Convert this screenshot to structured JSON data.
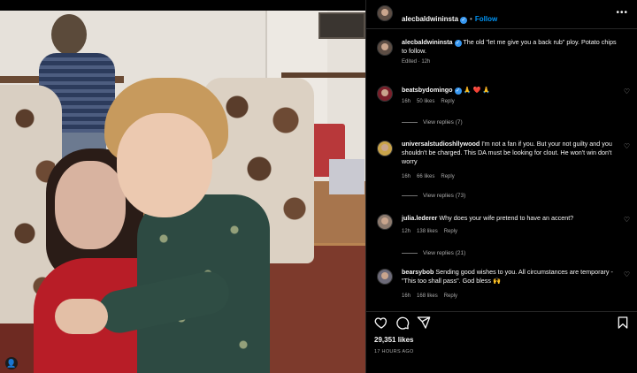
{
  "header": {
    "username": "alecbaldwininsta",
    "verified": true,
    "separator": "•",
    "follow_label": "Follow",
    "more_label": "•••"
  },
  "caption": {
    "username": "alecbaldwininsta",
    "text": "The old \"let me give you a back rub\" ploy. Potato chips to follow.",
    "meta": "Edited · 12h"
  },
  "comments": [
    {
      "username": "beatsbydomingo",
      "text": "🙏 ❤️ 🙏",
      "age": "16h",
      "likes": "50 likes",
      "reply": "Reply",
      "view_replies": "View replies (7)"
    },
    {
      "username": "universalstudioshllywood",
      "text": "I'm not a fan if you. But your not guilty and you shouldn't be charged. This DA must be looking for clout. He won't win don't worry",
      "age": "16h",
      "likes": "66 likes",
      "reply": "Reply",
      "view_replies": "View replies (73)"
    },
    {
      "username": "julia.lederer",
      "text": "Why does your wife pretend to have an accent?",
      "age": "12h",
      "likes": "138 likes",
      "reply": "Reply",
      "view_replies": "View replies (21)"
    },
    {
      "username": "bearsybob",
      "text": "Sending good wishes to you. All circumstances are temporary - \"This too shall pass\". God bless 🙌",
      "age": "16h",
      "likes": "168 likes",
      "reply": "Reply"
    }
  ],
  "actions": {
    "likes_count": "29,351 likes",
    "posted_ago": "17 HOURS AGO"
  },
  "icons": {
    "heart": "heart-icon",
    "comment": "comment-icon",
    "share": "share-icon",
    "save": "bookmark-icon",
    "tag": "user-tag-icon"
  },
  "colors": {
    "accent": "#0095f6",
    "verified": "#3797f0",
    "background": "#000000",
    "muted_text": "#a8a8a8"
  }
}
